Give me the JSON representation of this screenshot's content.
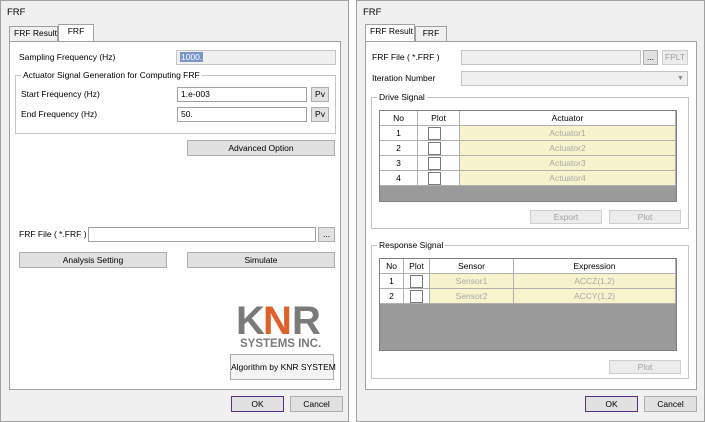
{
  "left_dialog": {
    "title": "FRF",
    "tabs": [
      {
        "label": "FRF Result",
        "active": false
      },
      {
        "label": "FRF",
        "active": true
      }
    ],
    "sampling_frequency": {
      "label": "Sampling Frequency (Hz)",
      "value": "1000."
    },
    "actuator_group": {
      "title": "Actuator Signal Generation for Computing FRF",
      "start_frequency": {
        "label": "Start Frequency (Hz)",
        "value": "1.e-003",
        "pv_label": "Pv"
      },
      "end_frequency": {
        "label": "End Frequency (Hz)",
        "value": "50.",
        "pv_label": "Pv"
      }
    },
    "advanced_option_label": "Advanced Option",
    "frf_file": {
      "label": "FRF File ( *.FRF )",
      "value": "",
      "browse_label": "..."
    },
    "analysis_setting_label": "Analysis Setting",
    "simulate_label": "Simulate",
    "logo": {
      "line1": "KNR",
      "line2": "SYSTEMS INC.",
      "colors": {
        "k_r": "#7a7a7a",
        "n": "#e0602a"
      }
    },
    "algorithm_label": "Algorithm by KNR SYSTEM",
    "ok_label": "OK",
    "cancel_label": "Cancel"
  },
  "right_dialog": {
    "title": "FRF",
    "tabs": [
      {
        "label": "FRF Result",
        "active": true
      },
      {
        "label": "FRF",
        "active": false
      }
    ],
    "frf_file": {
      "label": "FRF File ( *.FRF )",
      "value": "",
      "browse_label": "...",
      "fplt_label": "FPLT"
    },
    "iteration_number": {
      "label": "Iteration Number",
      "value": ""
    },
    "drive_signal": {
      "title": "Drive Signal",
      "columns": [
        "No",
        "Plot",
        "Actuator"
      ],
      "rows": [
        {
          "no": "1",
          "actuator": "Actuator1"
        },
        {
          "no": "2",
          "actuator": "Actuator2"
        },
        {
          "no": "3",
          "actuator": "Actuator3"
        },
        {
          "no": "4",
          "actuator": "Actuator4"
        }
      ],
      "export_label": "Export",
      "plot_label": "Plot"
    },
    "response_signal": {
      "title": "Response Signal",
      "columns": [
        "No",
        "Plot",
        "Sensor",
        "Expression"
      ],
      "rows": [
        {
          "no": "1",
          "sensor": "Sensor1",
          "expression": "ACCZ(1,2)"
        },
        {
          "no": "2",
          "sensor": "Sensor2",
          "expression": "ACCY(1,2)"
        }
      ],
      "plot_label": "Plot"
    },
    "ok_label": "OK",
    "cancel_label": "Cancel"
  }
}
